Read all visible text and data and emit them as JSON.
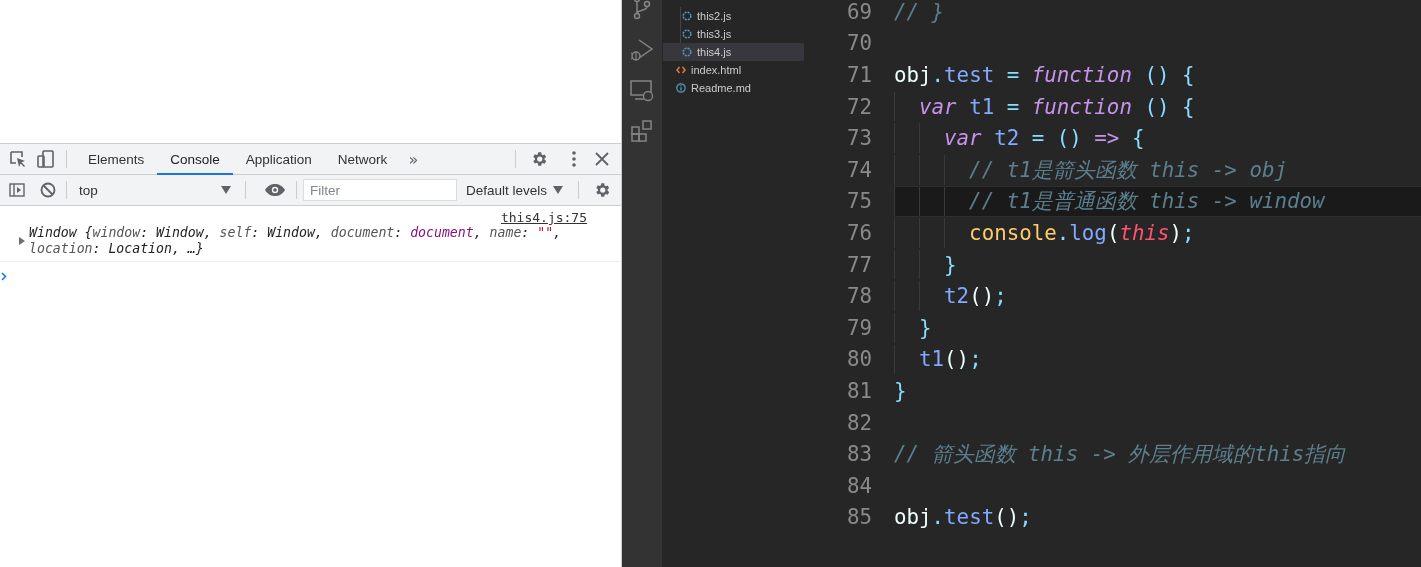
{
  "devtools": {
    "tabs": [
      {
        "label": "Elements",
        "selected": false
      },
      {
        "label": "Console",
        "selected": true
      },
      {
        "label": "Application",
        "selected": false
      },
      {
        "label": "Network",
        "selected": false
      }
    ],
    "overflow": "»",
    "context": "top",
    "filter": {
      "placeholder": "Filter"
    },
    "levels": "Default levels",
    "source_link": "this4.js:75",
    "message": [
      {
        "kind": "plain",
        "text": "Window {"
      },
      {
        "kind": "key",
        "text": "window"
      },
      {
        "kind": "plain",
        "text": ": Window, "
      },
      {
        "kind": "key",
        "text": "self"
      },
      {
        "kind": "plain",
        "text": ": Window, "
      },
      {
        "kind": "key",
        "text": "document"
      },
      {
        "kind": "plain",
        "text": ": "
      },
      {
        "kind": "object",
        "text": "document"
      },
      {
        "kind": "plain",
        "text": ", "
      },
      {
        "kind": "key",
        "text": "name"
      },
      {
        "kind": "plain",
        "text": ": "
      },
      {
        "kind": "string",
        "text": "\"\""
      },
      {
        "kind": "plain",
        "text": ", "
      },
      {
        "kind": "key",
        "text": "location"
      },
      {
        "kind": "plain",
        "text": ": Location, …}"
      }
    ],
    "message_expanded": false
  },
  "explorer": {
    "nested_files": [
      {
        "name": "this2.js",
        "kind": "js",
        "selected": false
      },
      {
        "name": "this3.js",
        "kind": "js",
        "selected": false
      },
      {
        "name": "this4.js",
        "kind": "js",
        "selected": true
      }
    ],
    "files": [
      {
        "name": "index.html",
        "kind": "html",
        "selected": false
      },
      {
        "name": "Readme.md",
        "kind": "md",
        "selected": false
      }
    ]
  },
  "editor": {
    "lines": [
      {
        "number": "69",
        "current": false,
        "tokens": [
          {
            "kind": "comment",
            "text": "// }"
          }
        ]
      },
      {
        "number": "70",
        "current": false
      },
      {
        "number": "71",
        "current": false,
        "tokens": [
          {
            "kind": "plain",
            "text": "obj"
          },
          {
            "kind": "op",
            "text": "."
          },
          {
            "kind": "prop",
            "text": "test"
          },
          {
            "kind": "op",
            "text": " = "
          },
          {
            "kind": "keyword",
            "text": "function"
          },
          {
            "kind": "op",
            "text": " ()"
          },
          {
            "kind": "op",
            "text": " {"
          }
        ]
      },
      {
        "number": "72",
        "current": false,
        "tokens": [
          {
            "kind": "keyword",
            "text": "  var"
          },
          {
            "kind": "prop",
            "text": " t1"
          },
          {
            "kind": "op",
            "text": " = "
          },
          {
            "kind": "keyword",
            "text": "function"
          },
          {
            "kind": "op",
            "text": " ()"
          },
          {
            "kind": "op",
            "text": " {"
          }
        ]
      },
      {
        "number": "73",
        "current": false,
        "tokens": [
          {
            "kind": "keyword",
            "text": "    var"
          },
          {
            "kind": "prop",
            "text": " t2"
          },
          {
            "kind": "op",
            "text": " = ()"
          },
          {
            "kind": "keyword",
            "text": " =>"
          },
          {
            "kind": "op",
            "text": " {"
          }
        ]
      },
      {
        "number": "74",
        "current": false,
        "tokens": [
          {
            "kind": "comment",
            "text": "      // t1是箭头函数 this -> obj"
          }
        ]
      },
      {
        "number": "75",
        "current": true,
        "tokens": [
          {
            "kind": "comment",
            "text": "      // t1是普通函数 this -> window"
          }
        ]
      },
      {
        "number": "76",
        "current": false,
        "tokens": [
          {
            "kind": "fn",
            "text": "      console"
          },
          {
            "kind": "op",
            "text": "."
          },
          {
            "kind": "prop",
            "text": "log"
          },
          {
            "kind": "plain",
            "text": "("
          },
          {
            "kind": "this",
            "text": "this"
          },
          {
            "kind": "plain",
            "text": ")"
          },
          {
            "kind": "op",
            "text": ";"
          }
        ]
      },
      {
        "number": "77",
        "current": false,
        "tokens": [
          {
            "kind": "op",
            "text": "    }"
          }
        ]
      },
      {
        "number": "78",
        "current": false,
        "tokens": [
          {
            "kind": "prop",
            "text": "    t2"
          },
          {
            "kind": "plain",
            "text": "()"
          },
          {
            "kind": "op",
            "text": ";"
          }
        ]
      },
      {
        "number": "79",
        "current": false,
        "tokens": [
          {
            "kind": "op",
            "text": "  }"
          }
        ]
      },
      {
        "number": "80",
        "current": false,
        "tokens": [
          {
            "kind": "prop",
            "text": "  t1"
          },
          {
            "kind": "plain",
            "text": "()"
          },
          {
            "kind": "op",
            "text": ";"
          }
        ]
      },
      {
        "number": "81",
        "current": false,
        "tokens": [
          {
            "kind": "op",
            "text": "}"
          }
        ]
      },
      {
        "number": "82",
        "current": false
      },
      {
        "number": "83",
        "current": false,
        "tokens": [
          {
            "kind": "comment",
            "text": "// 箭头函数 this -> 外层作用域的this指向"
          }
        ]
      },
      {
        "number": "84",
        "current": false
      },
      {
        "number": "85",
        "current": false,
        "tokens": [
          {
            "kind": "plain",
            "text": "obj"
          },
          {
            "kind": "op",
            "text": "."
          },
          {
            "kind": "prop",
            "text": "test"
          },
          {
            "kind": "plain",
            "text": "()"
          },
          {
            "kind": "op",
            "text": ";"
          }
        ]
      }
    ]
  }
}
